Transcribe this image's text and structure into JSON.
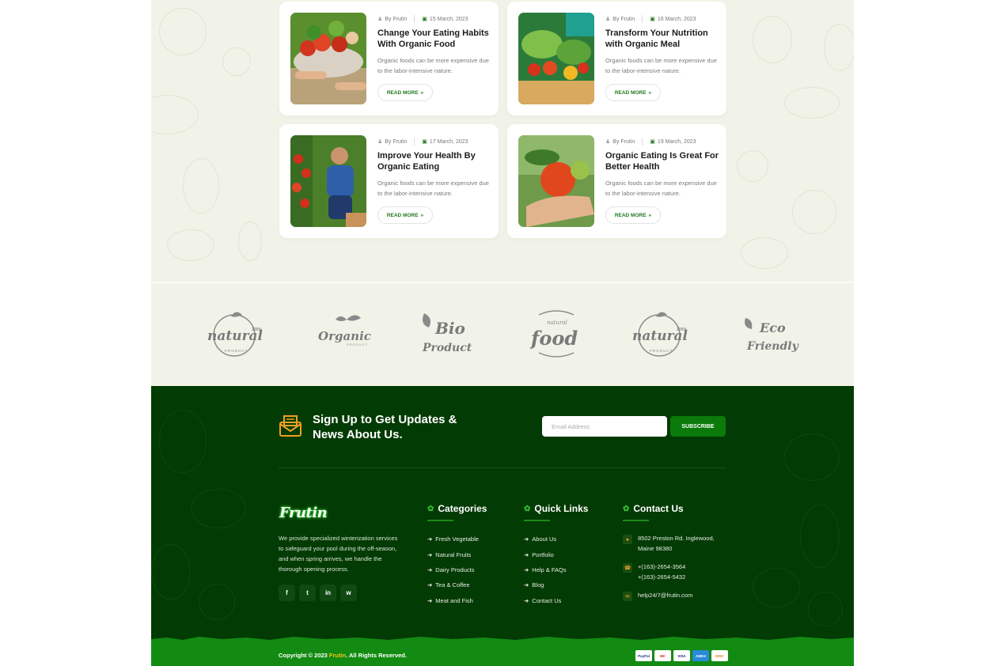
{
  "blog": {
    "posts": [
      {
        "author": "By Frutin",
        "date": "15 March, 2023",
        "title": "Change Your Eating Habits With Organic Food",
        "excerpt": "Organic foods can be more expensive due to the labor-intensive nature.",
        "cta": "READ MORE"
      },
      {
        "author": "By Frutin",
        "date": "16 March, 2023",
        "title": "Transform Your Nutrition with Organic Meal",
        "excerpt": "Organic foods can be more expensive due to the labor-intensive nature.",
        "cta": "READ MORE"
      },
      {
        "author": "By Frutin",
        "date": "17 March, 2023",
        "title": "Improve Your Health By Organic Eating",
        "excerpt": "Organic foods can be more expensive due to the labor-intensive nature.",
        "cta": "READ MORE"
      },
      {
        "author": "By Frutin",
        "date": "19 March, 2023",
        "title": "Organic Eating Is Great For Better Health",
        "excerpt": "Organic foods can be more expensive due to the labor-intensive nature.",
        "cta": "READ MORE"
      }
    ]
  },
  "brands": [
    {
      "name": "natural-100-logo",
      "text_main": "natural",
      "text_top": "100%",
      "text_bottom": "PRODUCT"
    },
    {
      "name": "organic-product-logo",
      "text_main": "Organic",
      "text_bottom": "PRODUCT"
    },
    {
      "name": "bio-product-logo",
      "text_main": "Bio",
      "text_bottom": "Product"
    },
    {
      "name": "natural-food-logo",
      "text_top": "natural",
      "text_main": "food"
    },
    {
      "name": "natural-100-logo-2",
      "text_main": "natural",
      "text_top": "100%",
      "text_bottom": "PRODUCT"
    },
    {
      "name": "eco-friendly-logo",
      "text_main": "Eco",
      "text_bottom": "Friendly"
    }
  ],
  "newsletter": {
    "title": "Sign Up to Get Updates & News About Us.",
    "email_placeholder": "Email Address",
    "button": "SUBSCRIBE"
  },
  "footer": {
    "logo": "Frutin",
    "about": "We provide specialized winterization services to safeguard your pool during the off-season, and when spring arrives, we handle the thorough opening process.",
    "social": [
      "f",
      "t",
      "in",
      "w"
    ],
    "categories": {
      "title": "Categories",
      "items": [
        "Fresh Vegetable",
        "Natural Fruits",
        "Dairy Products",
        "Tea & Coffee",
        "Meat and Fish"
      ]
    },
    "quick_links": {
      "title": "Quick Links",
      "items": [
        "About Us",
        "Portfolio",
        "Help & FAQs",
        "Blog",
        "Contact Us"
      ]
    },
    "contact": {
      "title": "Contact Us",
      "address_line1": "8502 Preston Rd. Inglewood,",
      "address_line2": "Maine 98380",
      "phone1": "+(163)-2654-3564",
      "phone2": "+(163)-2654-5432",
      "email": "help24/7@frutin.com"
    },
    "copyright_pre": "Copyright © 2023 ",
    "copyright_brand": "Frutin",
    "copyright_post": ". All Rights Reserved.",
    "payments": [
      "PayPal",
      "MC",
      "VISA",
      "AMEX",
      "DISC"
    ]
  },
  "colors": {
    "accent": "#1f7a1f",
    "footer_bg": "#033b04",
    "bottom_bar": "#138b13",
    "highlight": "#f5c518"
  }
}
